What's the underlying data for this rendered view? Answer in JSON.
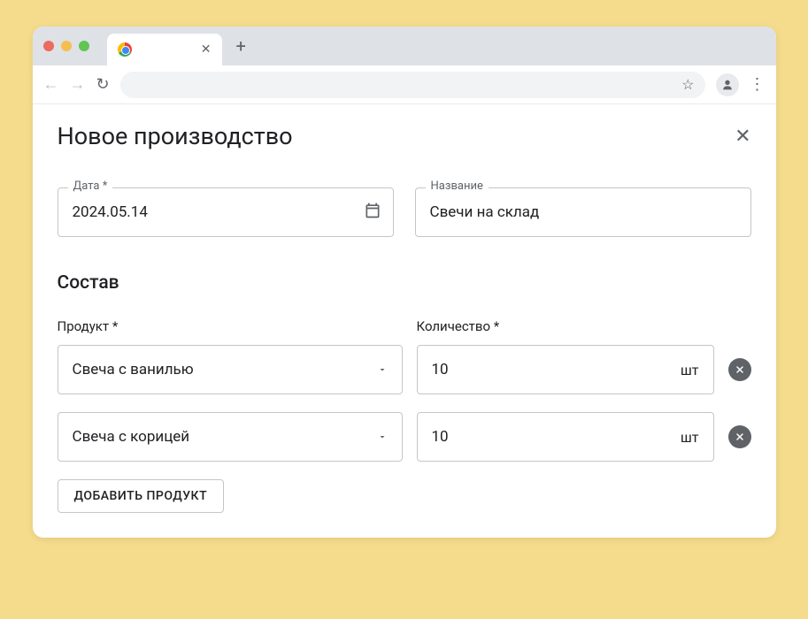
{
  "page": {
    "title": "Новое производство"
  },
  "fields": {
    "date": {
      "label": "Дата *",
      "value": "2024.05.14"
    },
    "name": {
      "label": "Название",
      "value": "Свечи на склад"
    }
  },
  "composition": {
    "title": "Состав",
    "columns": {
      "product": "Продукт *",
      "quantity": "Количество *"
    },
    "unit": "шт",
    "items": [
      {
        "product": "Свеча с ванилью",
        "qty": "10"
      },
      {
        "product": "Свеча с корицей",
        "qty": "10"
      }
    ],
    "add_label": "Добавить продукт"
  }
}
